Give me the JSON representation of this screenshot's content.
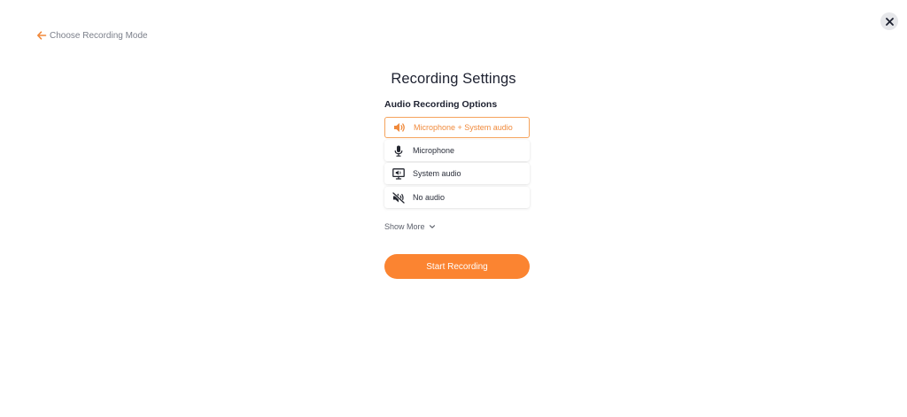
{
  "nav": {
    "back_label": "Choose Recording Mode",
    "back_icon": "arrow-left-icon",
    "close_icon": "close-icon"
  },
  "title": "Recording Settings",
  "audio": {
    "section_label": "Audio Recording Options",
    "selected": "Microphone + System audio",
    "options": [
      {
        "label": "Microphone + System audio",
        "icon": "speaker-icon",
        "selected": true
      },
      {
        "label": "Microphone",
        "icon": "microphone-icon",
        "selected": false
      },
      {
        "label": "System audio",
        "icon": "monitor-audio-icon",
        "selected": false
      },
      {
        "label": "No audio",
        "icon": "mute-icon",
        "selected": false
      }
    ]
  },
  "show_more": {
    "label": "Show More",
    "icon": "chevron-down-icon"
  },
  "start_button": {
    "label": "Start Recording"
  },
  "colors": {
    "accent": "#fb8431",
    "selected_border": "#f5a35c",
    "selected_text": "#f08a3c",
    "heading": "#1d2130",
    "muted": "#7b7f8a"
  }
}
